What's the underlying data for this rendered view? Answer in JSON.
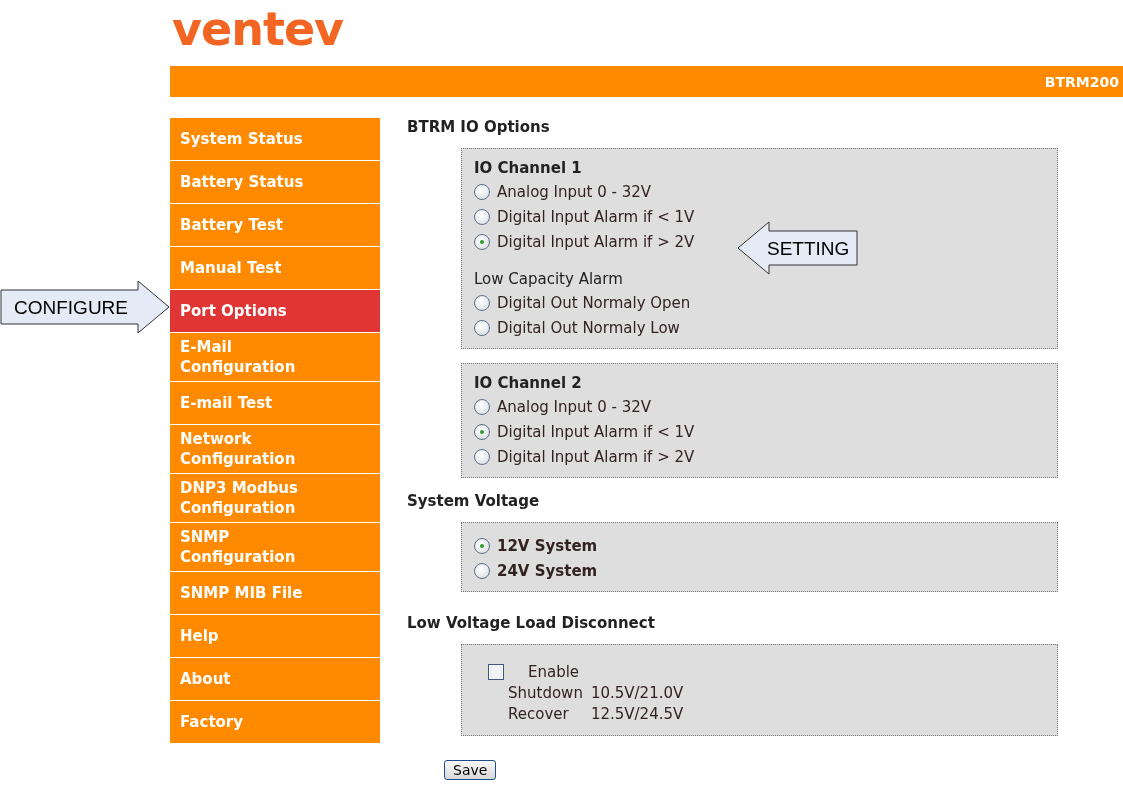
{
  "logo": {
    "text": "ventev"
  },
  "header": {
    "title": "BTRM200"
  },
  "sidebar": {
    "items": [
      {
        "label": "System Status",
        "selected": false
      },
      {
        "label": "Battery Status",
        "selected": false
      },
      {
        "label": "Battery Test",
        "selected": false
      },
      {
        "label": "Manual Test",
        "selected": false
      },
      {
        "label": "Port Options",
        "selected": true
      },
      {
        "label": "E-Mail Configuration",
        "selected": false
      },
      {
        "label": "E-mail Test",
        "selected": false
      },
      {
        "label": "Network Configuration",
        "selected": false
      },
      {
        "label": "DNP3 Modbus Configuration",
        "selected": false
      },
      {
        "label": "SNMP Configuration",
        "selected": false
      },
      {
        "label": "SNMP MIB File",
        "selected": false
      },
      {
        "label": "Help",
        "selected": false
      },
      {
        "label": "About",
        "selected": false
      },
      {
        "label": "Factory",
        "selected": false
      }
    ]
  },
  "sections": [
    {
      "title": "BTRM IO Options",
      "panels": [
        {
          "kind": "radios",
          "blocks": [
            {
              "title": "IO Channel 1",
              "kind": "title",
              "bold": false,
              "options": [
                {
                  "label": "Analog Input 0 - 32V",
                  "selected": false
                },
                {
                  "label": "Digital Input Alarm if < 1V",
                  "selected": false
                },
                {
                  "label": "Digital Input Alarm if > 2V",
                  "selected": true
                }
              ]
            },
            {
              "title": "Low Capacity Alarm",
              "kind": "subtitle",
              "bold": false,
              "options": [
                {
                  "label": "Digital Out Normaly Open",
                  "selected": false
                },
                {
                  "label": "Digital Out Normaly Low",
                  "selected": false
                }
              ]
            }
          ]
        },
        {
          "kind": "radios",
          "blocks": [
            {
              "title": "IO Channel 2",
              "kind": "title",
              "bold": false,
              "options": [
                {
                  "label": "Analog Input 0 - 32V",
                  "selected": false
                },
                {
                  "label": "Digital Input Alarm if < 1V",
                  "selected": true
                },
                {
                  "label": "Digital Input Alarm if > 2V",
                  "selected": false
                }
              ]
            }
          ]
        }
      ]
    },
    {
      "title": "System Voltage",
      "panels": [
        {
          "kind": "radios",
          "blocks": [
            {
              "kind": "none",
              "bold": true,
              "options": [
                {
                  "label": "12V System",
                  "selected": true
                },
                {
                  "label": "24V System",
                  "selected": false
                }
              ]
            }
          ]
        }
      ]
    },
    {
      "title": "Low Voltage Load Disconnect",
      "panels": [
        {
          "kind": "checkbox",
          "label": "Enable",
          "checked": false,
          "rows": [
            {
              "label": "Shutdown",
              "value": "10.5V/21.0V"
            },
            {
              "label": "Recover",
              "value": "12.5V/24.5V"
            }
          ]
        }
      ]
    }
  ],
  "buttons": [
    {
      "label": "Save"
    }
  ],
  "annotations": [
    {
      "text": "CONFIGURE",
      "kind": "right"
    },
    {
      "text": "SETTING",
      "kind": "left"
    }
  ]
}
